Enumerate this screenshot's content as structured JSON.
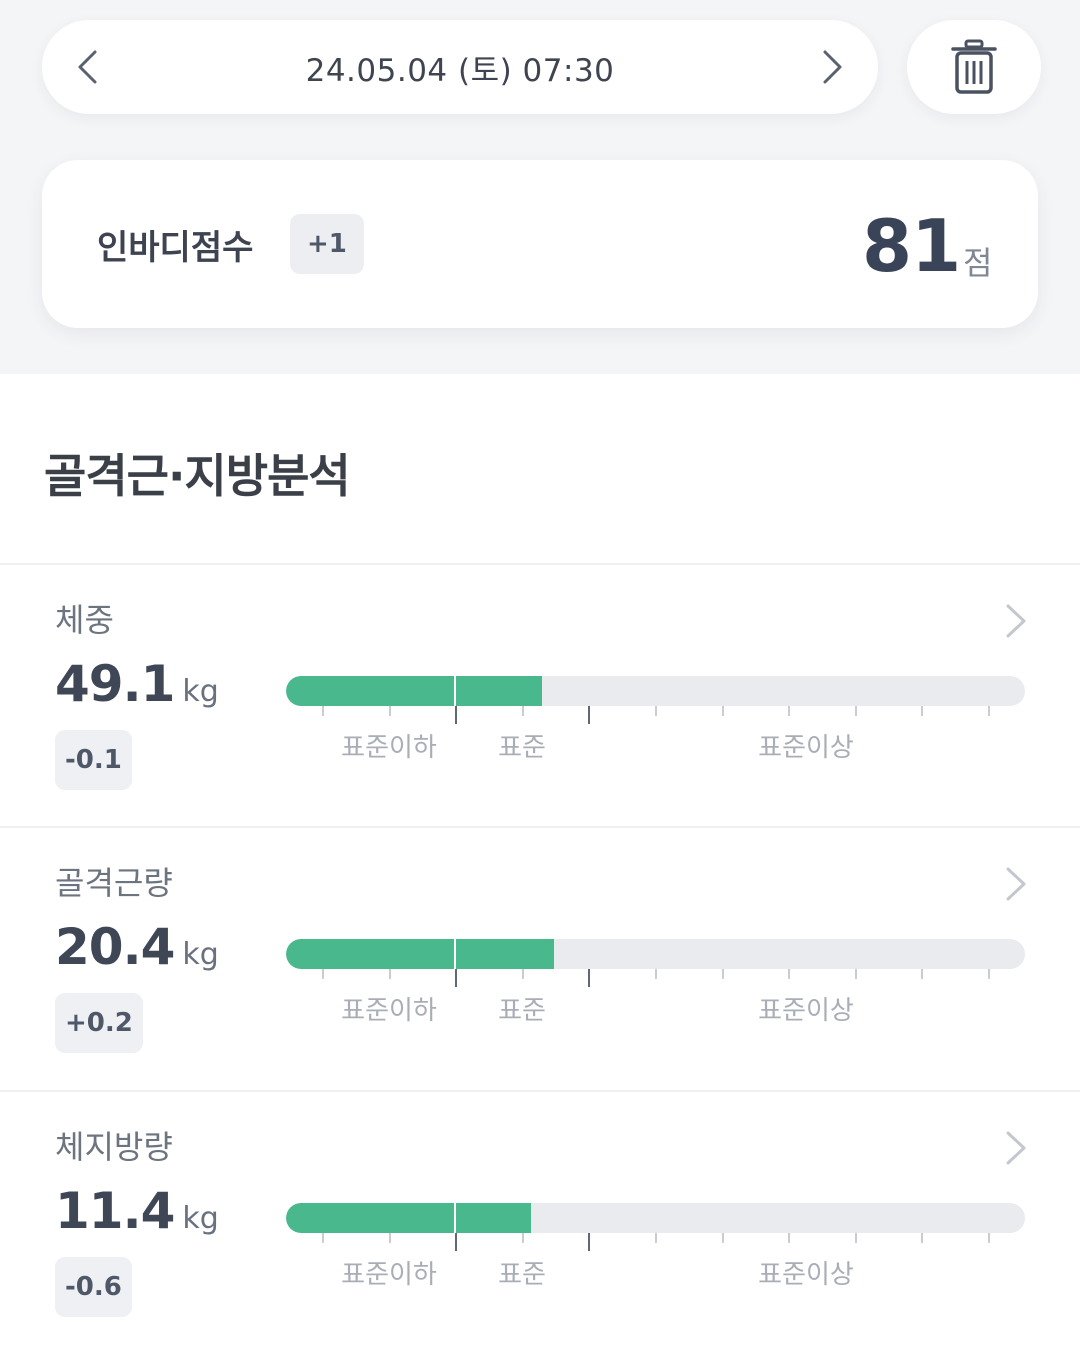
{
  "header": {
    "date_label": "24.05.04 (토) 07:30",
    "prev_icon": "chevron-left-icon",
    "next_icon": "chevron-right-icon",
    "delete_icon": "trash-icon"
  },
  "score_card": {
    "label": "인바디점수",
    "delta": "+1",
    "value": "81",
    "unit": "점"
  },
  "section": {
    "title": "골격근·지방분석"
  },
  "range_labels": {
    "below": "표준이하",
    "standard": "표준",
    "above": "표준이상"
  },
  "metrics": [
    {
      "name": "체중",
      "value": "49.1",
      "unit": "kg",
      "delta": "-0.1",
      "bar_level": 0.347
    },
    {
      "name": "골격근량",
      "value": "20.4",
      "unit": "kg",
      "delta": "+0.2",
      "bar_level": 0.363
    },
    {
      "name": "체지방량",
      "value": "11.4",
      "unit": "kg",
      "delta": "-0.6",
      "bar_level": 0.332
    }
  ],
  "colors": {
    "bar_fill": "#49b88c",
    "bar_track": "#e9ebee",
    "top_background": "#f4f5f7"
  }
}
